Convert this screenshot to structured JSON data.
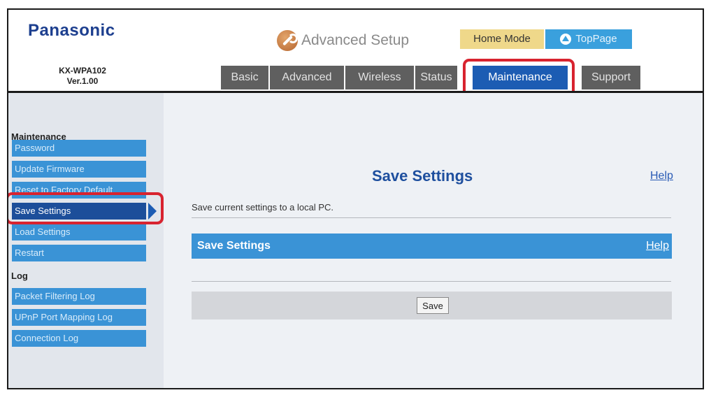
{
  "header": {
    "brand": "Panasonic",
    "model": "KX-WPA102",
    "version": "Ver.1.00",
    "app_title": "Advanced Setup",
    "home_mode": "Home Mode",
    "toppage": "TopPage"
  },
  "tabs": [
    {
      "label": "Basic"
    },
    {
      "label": "Advanced"
    },
    {
      "label": "Wireless"
    },
    {
      "label": "Status"
    },
    {
      "label": "Maintenance",
      "active": true
    },
    {
      "label": "Support"
    }
  ],
  "sidebar": {
    "sections": [
      {
        "title": "Maintenance"
      },
      {
        "title": "Log"
      }
    ],
    "items": [
      {
        "label": "Password"
      },
      {
        "label": "Update Firmware"
      },
      {
        "label": "Reset to Factory Default"
      },
      {
        "label": "Save Settings",
        "active": true
      },
      {
        "label": "Load Settings"
      },
      {
        "label": "Restart"
      },
      {
        "label": "Packet Filtering Log"
      },
      {
        "label": "UPnP Port Mapping Log"
      },
      {
        "label": "Connection Log"
      }
    ]
  },
  "main": {
    "title": "Save Settings",
    "help": "Help",
    "description": "Save current settings to a local PC.",
    "section": {
      "title": "Save Settings",
      "help": "Help"
    },
    "save_button": "Save"
  },
  "colors": {
    "tab_active": "#1c5cb3",
    "tab_inactive": "#5f5f5f",
    "sidebar_item": "#3a93d6",
    "sidebar_item_active": "#1c4e9a",
    "highlight": "#d8232f",
    "brand": "#1d3f8f"
  }
}
